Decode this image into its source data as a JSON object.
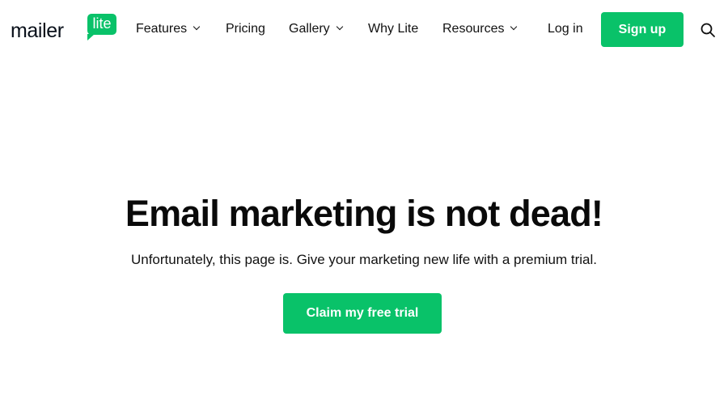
{
  "logo": {
    "word": "mailer",
    "badge": "lite"
  },
  "nav": {
    "features": "Features",
    "pricing": "Pricing",
    "gallery": "Gallery",
    "why_lite": "Why Lite",
    "resources": "Resources",
    "login": "Log in",
    "signup": "Sign up"
  },
  "hero": {
    "headline": "Email marketing is not dead!",
    "subline": "Unfortunately, this page is. Give your marketing new life with a premium trial.",
    "cta": "Claim my free trial"
  },
  "icons": {
    "search": "search-icon",
    "dropdown": "chevron-down-icon"
  },
  "colors": {
    "brand_green": "#09c269",
    "text": "#111111",
    "background": "#ffffff"
  }
}
